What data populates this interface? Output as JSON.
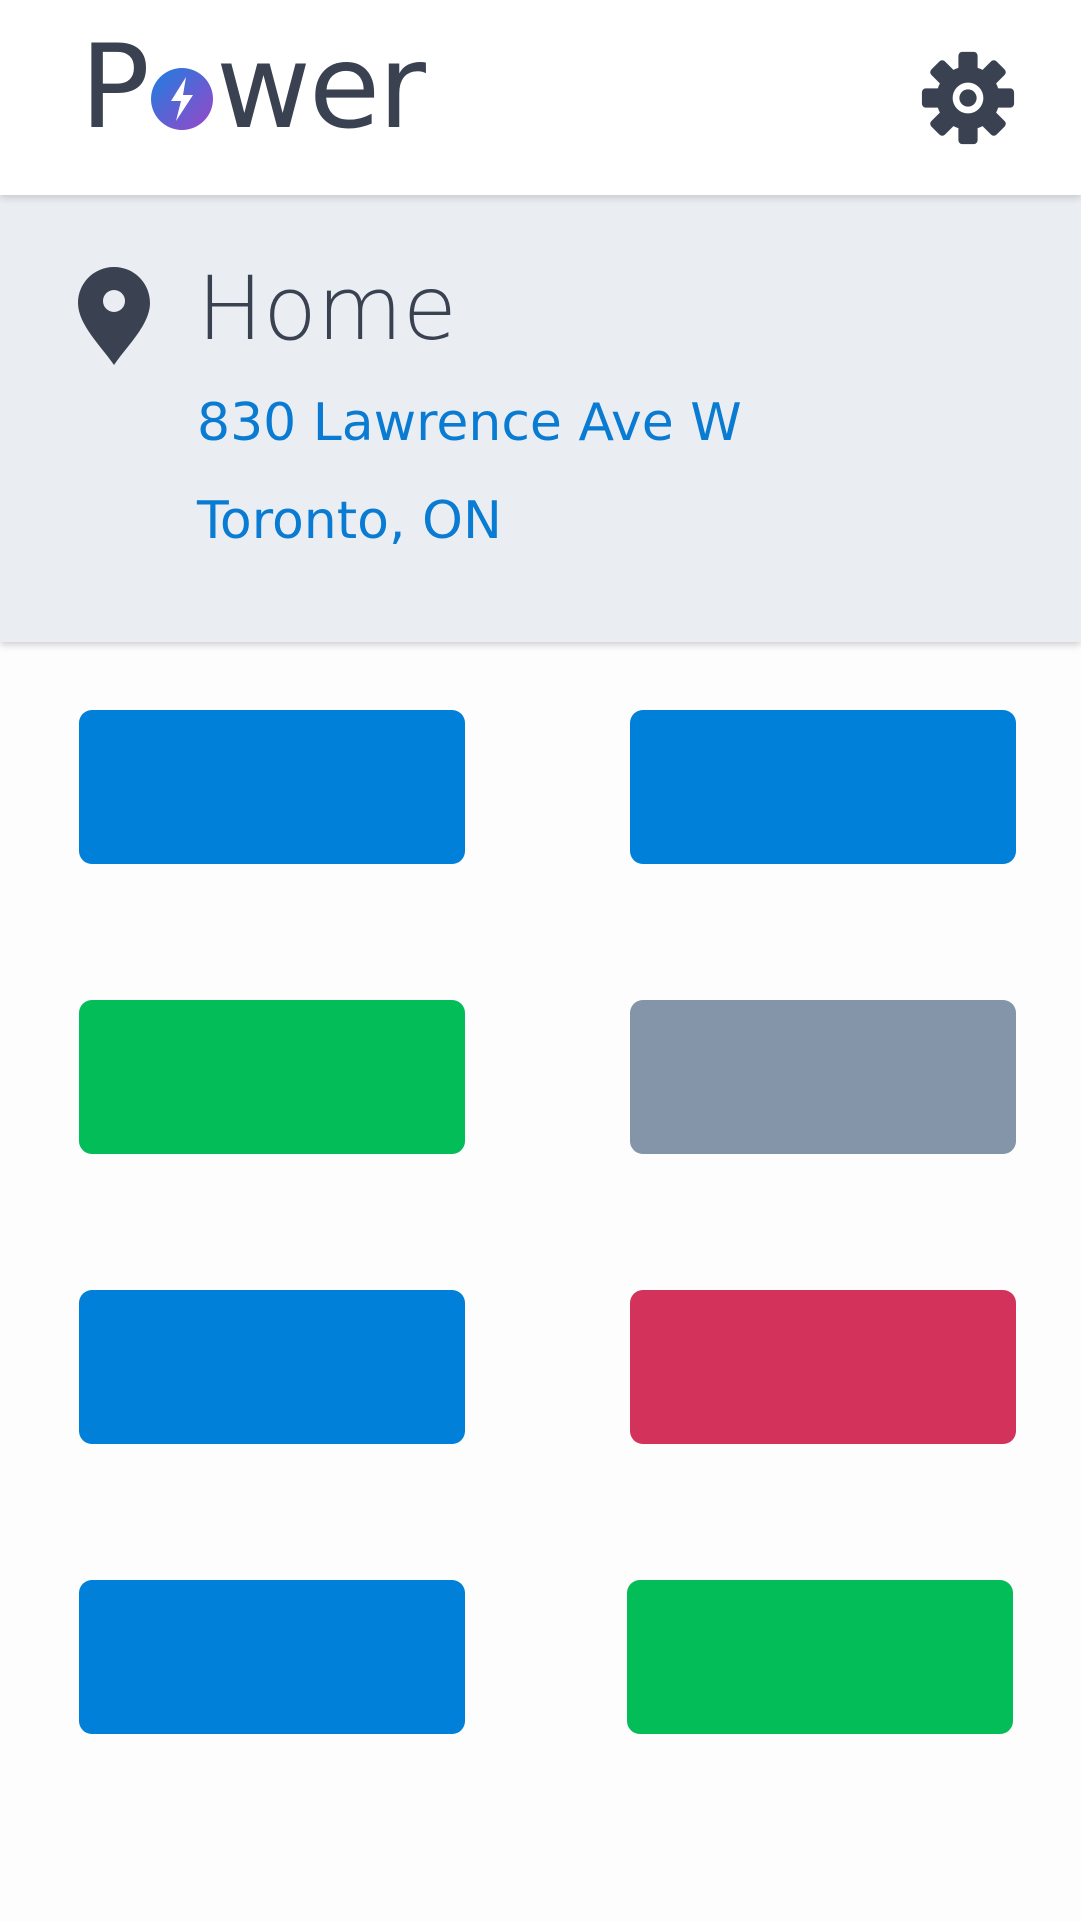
{
  "app": {
    "logo_left": "P",
    "logo_right": "wer",
    "logo_icon": "bolt-circle-icon",
    "settings_icon": "gear-icon"
  },
  "location": {
    "icon": "map-pin-icon",
    "name": "Home",
    "address_line1": "830 Lawrence Ave W",
    "address_line2": "Toronto, ON"
  },
  "tiles": [
    {
      "color": "#0080d8"
    },
    {
      "color": "#0080d8"
    },
    {
      "color": "#02bd58"
    },
    {
      "color": "#8494a9"
    },
    {
      "color": "#0080d8"
    },
    {
      "color": "#d3335b"
    },
    {
      "color": "#0080d8"
    },
    {
      "color": "#02bd58"
    }
  ],
  "colors": {
    "primary": "#0080d8",
    "text_dark": "#3a4252",
    "link": "#0a7bd2",
    "panel_bg": "#eaeef3"
  }
}
